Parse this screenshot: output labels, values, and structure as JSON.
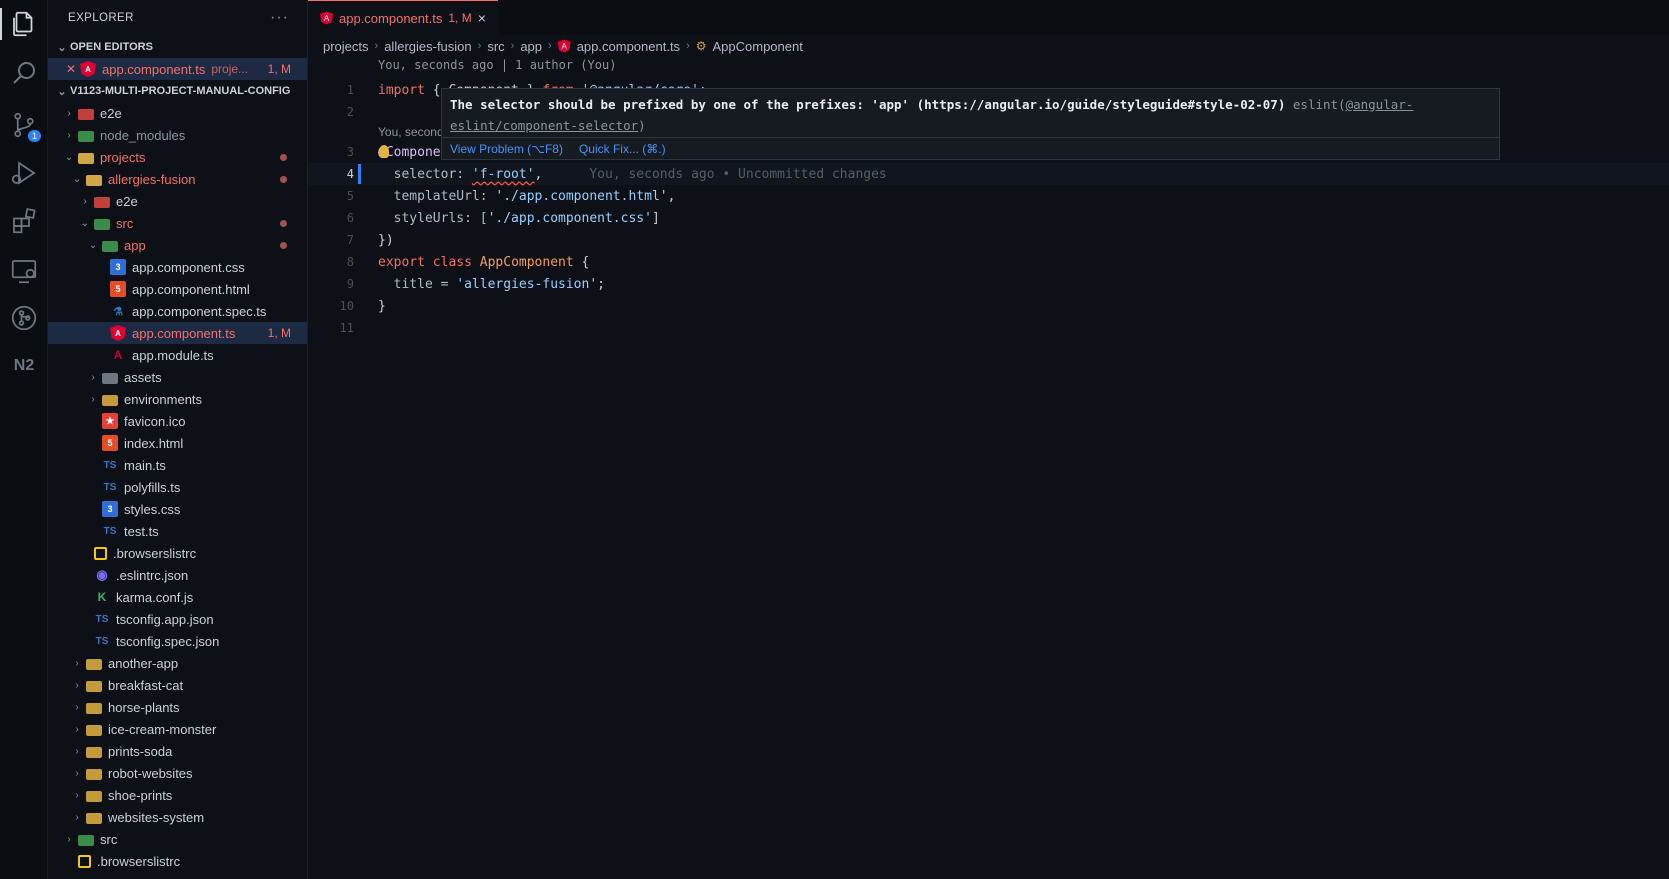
{
  "activity_bar": {
    "icons": [
      "explorer-icon",
      "search-icon",
      "source-control-icon",
      "run-debug-icon",
      "extensions-icon",
      "remote-explorer-icon",
      "git-graph-icon",
      "nx-console-icon"
    ],
    "scm_badge": "1",
    "nx_label": "N2"
  },
  "sidebar": {
    "title": "EXPLORER",
    "more": "···",
    "open_editors": {
      "header": "OPEN EDITORS",
      "items": [
        {
          "label": "app.component.ts",
          "desc": "proje...",
          "status": "1, M"
        }
      ]
    },
    "workspace": {
      "header": "V1123-MULTI-PROJECT-MANUAL-CONFIG",
      "tree": [
        {
          "label": "e2e"
        },
        {
          "label": "node_modules"
        },
        {
          "label": "projects"
        },
        {
          "label": "allergies-fusion"
        },
        {
          "label": "e2e"
        },
        {
          "label": "src"
        },
        {
          "label": "app"
        },
        {
          "label": "app.component.css"
        },
        {
          "label": "app.component.html"
        },
        {
          "label": "app.component.spec.ts"
        },
        {
          "label": "app.component.ts",
          "status": "1, M"
        },
        {
          "label": "app.module.ts"
        },
        {
          "label": "assets"
        },
        {
          "label": "environments"
        },
        {
          "label": "favicon.ico"
        },
        {
          "label": "index.html"
        },
        {
          "label": "main.ts"
        },
        {
          "label": "polyfills.ts"
        },
        {
          "label": "styles.css"
        },
        {
          "label": "test.ts"
        },
        {
          "label": ".browserslistrc"
        },
        {
          "label": ".eslintrc.json"
        },
        {
          "label": "karma.conf.js"
        },
        {
          "label": "tsconfig.app.json"
        },
        {
          "label": "tsconfig.spec.json"
        },
        {
          "label": "another-app"
        },
        {
          "label": "breakfast-cat"
        },
        {
          "label": "horse-plants"
        },
        {
          "label": "ice-cream-monster"
        },
        {
          "label": "prints-soda"
        },
        {
          "label": "robot-websites"
        },
        {
          "label": "shoe-prints"
        },
        {
          "label": "websites-system"
        },
        {
          "label": "src"
        },
        {
          "label": ".browserslistrc"
        }
      ]
    }
  },
  "editor": {
    "tab": {
      "label": "app.component.ts",
      "status": "1, M",
      "close": "×"
    },
    "breadcrumb": [
      "projects",
      "allergies-fusion",
      "src",
      "app",
      "app.component.ts",
      "AppComponent"
    ],
    "codelens_top": "You, seconds ago | 1 author (You)",
    "codelens_mid": "You, seconds ag",
    "line_numbers": [
      "1",
      "2",
      "3",
      "4",
      "5",
      "6",
      "7",
      "8",
      "9",
      "10",
      "11"
    ],
    "code": {
      "l1_import": "import",
      "l1_brace": " { Component } ",
      "l1_from": "from",
      "l1_str": " '@angular/core';",
      "l3_at": "@",
      "l3_fn": "Component",
      "l3_paren": "({",
      "l4_prop": "  selector: ",
      "l4_str": "'f-root'",
      "l4_comma": ",",
      "l4_blame": "You, seconds ago • Uncommitted changes",
      "l5_prop": "  templateUrl: ",
      "l5_str": "'./app.component.html'",
      "l5_comma": ",",
      "l6_prop": "  styleUrls: [",
      "l6_str": "'./app.component.css'",
      "l6_close": "]",
      "l7": "})",
      "l8_export": "export",
      "l8_class": " class ",
      "l8_name": "AppComponent",
      "l8_brace": " {",
      "l9_prop": "  title = ",
      "l9_str": "'allergies-fusion'",
      "l9_semi": ";",
      "l10": "}"
    },
    "hover": {
      "message": "The selector should be prefixed by one of the prefixes: 'app' (https://angular.io/guide/styleguide#style-02-07)",
      "source": "eslint(",
      "rule_a": "@angular-",
      "rule_b": "eslint/component-selector",
      "source_close": ")",
      "view_problem": "View Problem (⌥F8)",
      "quick_fix": "Quick Fix... (⌘.)"
    }
  }
}
